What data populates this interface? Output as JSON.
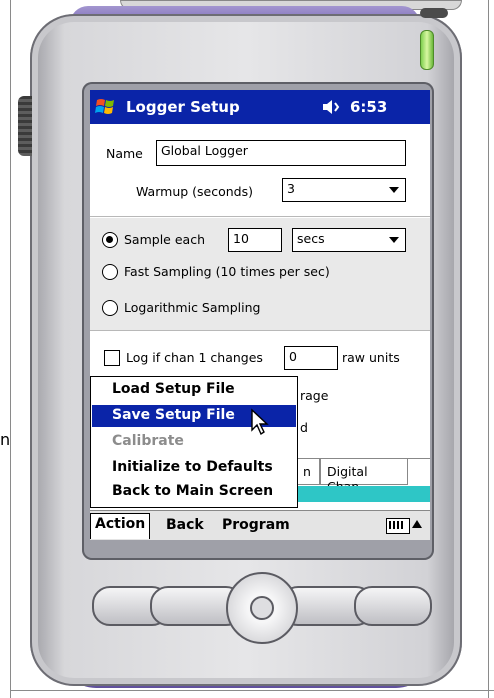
{
  "window": {
    "title": "Logger Setup",
    "time": "6:53"
  },
  "form": {
    "name_label": "Name",
    "name_value": "Global Logger",
    "warmup_label": "Warmup (seconds)",
    "warmup_value": "3",
    "sample_each_label": "Sample each",
    "sample_each_value": "10",
    "sample_unit": "secs",
    "fast_sampling_label": "Fast Sampling (10 times per sec)",
    "log_sampling_label": "Logarithmic Sampling",
    "log_if_label": "Log if chan 1 changes",
    "log_if_value": "0",
    "raw_units_label": "raw units",
    "hidden_partial_1": "rage",
    "hidden_partial_2": "d"
  },
  "tabs": [
    {
      "label": "n"
    },
    {
      "label": "Digital Chan"
    }
  ],
  "popup_menu": {
    "items": [
      {
        "label": "Load Setup File",
        "state": "normal"
      },
      {
        "label": "Save Setup File",
        "state": "selected"
      },
      {
        "label": "Calibrate",
        "state": "disabled"
      },
      {
        "label": "Initialize to Defaults",
        "state": "normal"
      },
      {
        "label": "Back to Main Screen",
        "state": "normal"
      }
    ]
  },
  "menubar": {
    "action": "Action",
    "back": "Back",
    "program": "Program"
  },
  "colors": {
    "titlebar": "#0a24a8",
    "selection": "#0a24a8",
    "teal_strip": "#2ec6c6",
    "device_accent": "#7d6db8"
  },
  "icons": [
    "windows-flag-icon",
    "speaker-icon",
    "keyboard-icon",
    "up-arrow-icon",
    "arrow-cursor-icon"
  ],
  "background": {
    "edge_text": "n"
  }
}
